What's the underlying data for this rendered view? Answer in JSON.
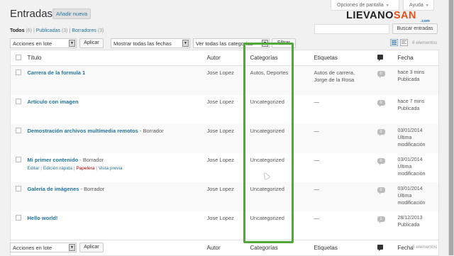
{
  "header": {
    "title": "Entradas",
    "add_new": "Añadir nueva",
    "screen_options": "Opciones de pantalla",
    "help": "Ayuda"
  },
  "brand": {
    "part1": "LIEVANO",
    "part2": "SAN",
    "domain": ".com"
  },
  "filters": {
    "all": "Todos",
    "all_count": "(6)",
    "published": "Publicadas",
    "published_count": "(3)",
    "drafts": "Borradores",
    "drafts_count": "(3)",
    "sep": "|"
  },
  "search": {
    "placeholder": "",
    "button": "Buscar entradas"
  },
  "toolbar": {
    "bulk_actions": "Acciones en lote",
    "apply": "Aplicar",
    "dates": "Mostrar todas las fechas",
    "categories": "Ver todas las categorías",
    "filter": "Filtrar",
    "items_count": "6 elementos"
  },
  "columns": {
    "title": "Título",
    "author": "Autor",
    "categories": "Categorías",
    "tags": "Etiquetas",
    "date": "Fecha"
  },
  "posts": [
    {
      "title": "Carrera de la formula 1",
      "state": "",
      "author": "Jose Lopez",
      "categories": "Autos, Deportes",
      "tags": "Autos de carrera, Jorge de la Rosa",
      "comments": "0",
      "date1": "hace 3 mins",
      "date2": "Publicada",
      "date3": ""
    },
    {
      "title": "Artículo con imagen",
      "state": "",
      "author": "Jose Lopez",
      "categories": "Uncategorized",
      "tags": "—",
      "comments": "0",
      "date1": "hace 7 mins",
      "date2": "Publicada",
      "date3": ""
    },
    {
      "title": "Demostración archivos multimedia remotos",
      "state": " - Borrador",
      "author": "Jose Lopez",
      "categories": "Uncategorized",
      "tags": "—",
      "comments": "0",
      "date1": "03/01/2014",
      "date2": "Última",
      "date3": "modificación"
    },
    {
      "title": "Mi primer contenido",
      "state": " - Borrador",
      "author": "Jose Lopez",
      "categories": "Uncategorized",
      "tags": "—",
      "comments": "0",
      "date1": "03/01/2014",
      "date2": "Última",
      "date3": "modificación",
      "actions": {
        "edit": "Editar",
        "quick_edit": "Edición rápida",
        "trash": "Papelera",
        "preview": "Vista previa",
        "sep": "|"
      }
    },
    {
      "title": "Galería de imágenes",
      "state": " - Borrador",
      "author": "Jose Lopez",
      "categories": "Uncategorized",
      "tags": "—",
      "comments": "0",
      "date1": "03/01/2014",
      "date2": "Última",
      "date3": "modificación"
    },
    {
      "title": "Hello world!",
      "state": "",
      "author": "Jose Lopez",
      "categories": "Uncategorized",
      "tags": "—",
      "comments": "1",
      "date1": "28/12/2013",
      "date2": "Publicada",
      "date3": ""
    }
  ],
  "colors": {
    "link": "#21759b",
    "highlight": "#52a73a",
    "trash": "#aa0000"
  }
}
